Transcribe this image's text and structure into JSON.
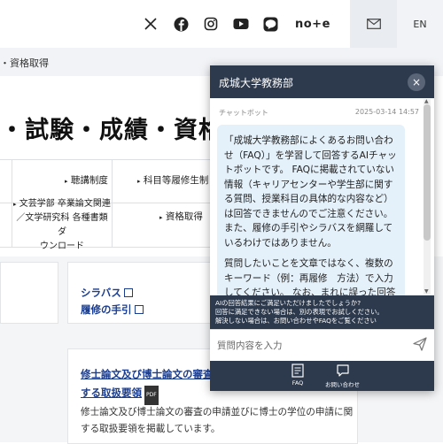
{
  "header": {
    "social": [
      {
        "name": "x-icon"
      },
      {
        "name": "facebook-icon"
      },
      {
        "name": "instagram-icon"
      },
      {
        "name": "youtube-icon"
      },
      {
        "name": "line-icon"
      }
    ],
    "note_label": "no+e",
    "lang_label": "EN"
  },
  "breadcrumb": "・資格取得",
  "page_title": "・試験・成績・資格取",
  "menu": {
    "item1": "聴講制度",
    "item2": "科目等履修生制",
    "item3_line1": "文芸学部 卒業論文関連",
    "item3_line2": "／文学研究科 各種書類ダ",
    "item3_line3": "ウンロード",
    "item4": "資格取得"
  },
  "cards": {
    "syllabus": "シラバス",
    "guide": "履修の手引",
    "thesis_link_line1": "修士論文及び博士論文の審査の申",
    "thesis_link_line2": "する取扱要領",
    "pdf_label": "PDF",
    "thesis_desc_line1": "修士論文及び博士論文の審査の申請並びに博士の学位の申請に関",
    "thesis_desc_line2": "する取扱要領を掲載しています。"
  },
  "chat": {
    "title": "成城大学教務部",
    "close": "×",
    "sender": "チャットボット",
    "timestamp": "2025-03-14 14:57",
    "message_p1": "「成城大学教務部によくあるお問い合わせ（FAQ）」を学習して回答するAIチャットボットです。 FAQに掲載されていない情報（キャリアセンターや学生部に関する質問、授業科目の具体的な内容など）は回答できませんのでご注意ください。また、履修の手引やシラバスを網羅しているわけではありません。",
    "message_p2": "質問したいことを文章ではなく、複数のキーワード（例：再履修　方法）で入力してください。 なお、まれに誤った回答をしてしまう場合もありますので、回答内容に疑問を感じた場合や回答の根拠等については、教務部",
    "notice_line1": "AIの回答結果にご満足いただけましたでしょうか?",
    "notice_line2": "回答に満足できない場合は、別の表現でお試しください。",
    "notice_line3": "解決しない場合は、お問い合わせやFAQをご覧ください",
    "input_placeholder": "質問内容を入力",
    "faq_label": "FAQ",
    "contact_label": "お問い合わせ"
  }
}
